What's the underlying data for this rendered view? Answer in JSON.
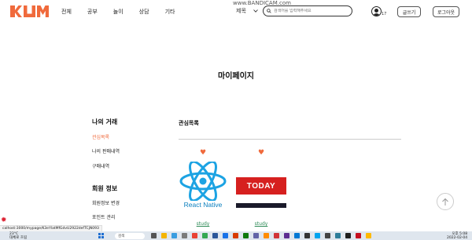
{
  "header": {
    "nav": [
      "전체",
      "공부",
      "놀이",
      "상담",
      "기타"
    ],
    "search_select": "제목",
    "search_placeholder": "검색어를 입력해주세요",
    "notif_count": "17",
    "write_label": "글쓰기",
    "logout_label": "로그아웃",
    "recorder_watermark": "www.BANDICAM.com"
  },
  "page": {
    "title": "마이페이지"
  },
  "sidebar": {
    "group1_heading": "나의 거래",
    "group1_items": [
      "관심목록",
      "나의 판매내역",
      "구매내역"
    ],
    "group2_heading": "회원 정보",
    "group2_items": [
      "회원정보 변경",
      "포인트 관리"
    ]
  },
  "main": {
    "section_title": "관심목록",
    "cards": [
      {
        "caption": "React Native",
        "label": "study"
      },
      {
        "caption": "TODAY",
        "label": "study"
      }
    ]
  },
  "status_url": "calhost:3000/mypage/K3eYlatMfGdvU2922defTCjN093",
  "taskbar": {
    "temp": "23°C",
    "weather": "대체로 흐림",
    "search": "검색",
    "time": "오후 5:08",
    "date": "2022-02-04"
  },
  "colors": {
    "accent": "#f06a3c",
    "link": "#2e8b57",
    "react_blue": "#0b7fbe",
    "today_red": "#d6201f"
  }
}
